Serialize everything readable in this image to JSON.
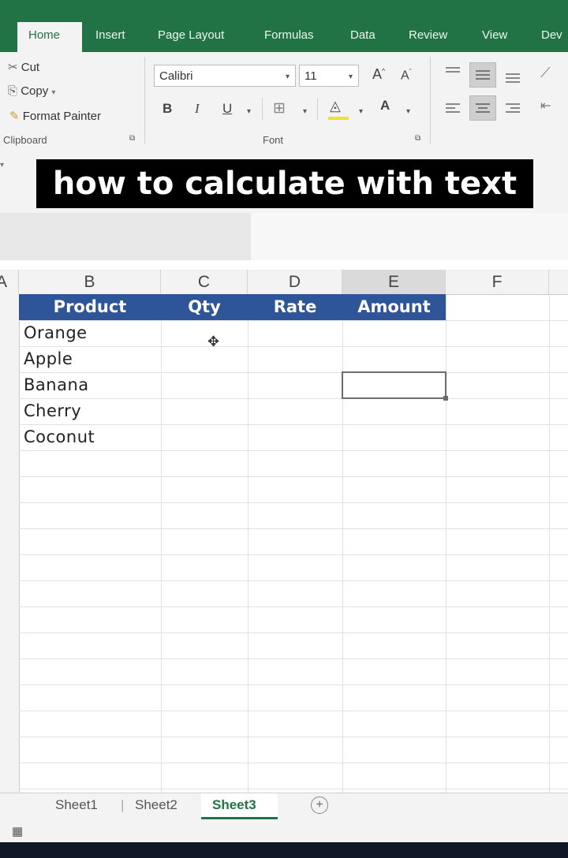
{
  "ribbon_tabs": [
    "Home",
    "Insert",
    "Page Layout",
    "Formulas",
    "Data",
    "Review",
    "View",
    "Dev"
  ],
  "clipboard": {
    "cut": "Cut",
    "copy": "Copy",
    "format_painter": "Format Painter",
    "group_label": "Clipboard"
  },
  "font": {
    "name": "Calibri",
    "size": "11",
    "bold": "B",
    "italic": "I",
    "underline": "U",
    "grow": "A",
    "shrink": "A",
    "color": "A",
    "group_label": "Font"
  },
  "caption": "how to calculate with text",
  "columns": [
    "A",
    "B",
    "C",
    "D",
    "E",
    "F"
  ],
  "table": {
    "headers": [
      "Product",
      "Qty",
      "Rate",
      "Amount"
    ],
    "rows": [
      "Orange",
      "Apple",
      "Banana",
      "Cherry",
      "Coconut"
    ]
  },
  "sheet_tabs": [
    "Sheet1",
    "Sheet2",
    "Sheet3"
  ],
  "active_sheet": "Sheet3",
  "selected_cell": "E",
  "colors": {
    "ribbon": "#217346",
    "table_header": "#2e5597"
  }
}
